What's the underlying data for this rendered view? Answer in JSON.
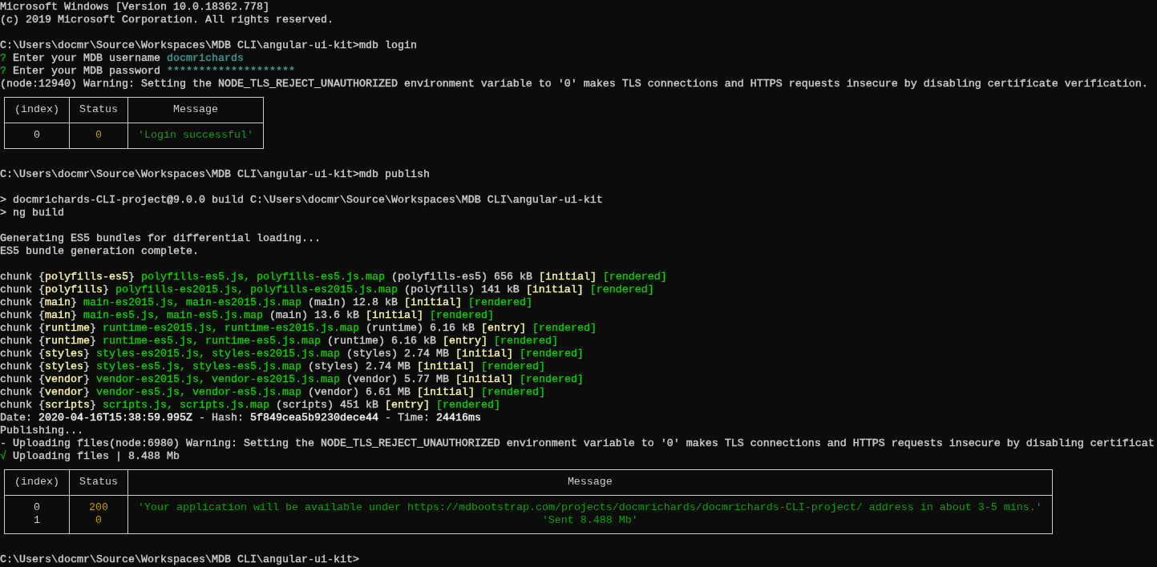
{
  "console": {
    "lines": [
      {
        "kind": "text",
        "segments": [
          {
            "text": "Microsoft Windows [Version 10.0.18362.778]",
            "color": "#cccccc"
          }
        ]
      },
      {
        "kind": "text",
        "segments": [
          {
            "text": "(c) 2019 Microsoft Corporation. All rights reserved.",
            "color": "#cccccc"
          }
        ]
      },
      {
        "kind": "blank"
      },
      {
        "kind": "text",
        "segments": [
          {
            "text": "C:\\Users\\docmr\\Source\\Workspaces\\MDB CLI\\angular-ui-kit>mdb login",
            "color": "#cccccc"
          }
        ]
      },
      {
        "kind": "text",
        "segments": [
          {
            "text": "?",
            "color": "#13a10e"
          },
          {
            "text": " Enter your MDB username ",
            "color": "#cccccc"
          },
          {
            "text": "docmrichards",
            "color": "#3a9a8f"
          }
        ]
      },
      {
        "kind": "text",
        "segments": [
          {
            "text": "?",
            "color": "#13a10e"
          },
          {
            "text": " Enter your MDB password ",
            "color": "#cccccc"
          },
          {
            "text": "********************",
            "color": "#3a9a8f"
          }
        ]
      },
      {
        "kind": "text",
        "segments": [
          {
            "text": "(node:12940) Warning: Setting the NODE_TLS_REJECT_UNAUTHORIZED environment variable to '0' makes TLS connections and HTTPS requests insecure by disabling certificate verification.",
            "color": "#cccccc"
          }
        ]
      },
      {
        "kind": "table",
        "columns": [
          "(index)",
          "Status",
          "Message"
        ],
        "rows": [
          [
            {
              "text": "0",
              "color": "#cccccc"
            },
            {
              "text": "0",
              "color": "#c19c00"
            },
            {
              "text": "'Login successful'",
              "color": "#13a10e"
            }
          ]
        ]
      },
      {
        "kind": "blank"
      },
      {
        "kind": "text",
        "segments": [
          {
            "text": "C:\\Users\\docmr\\Source\\Workspaces\\MDB CLI\\angular-ui-kit>mdb publish",
            "color": "#cccccc"
          }
        ]
      },
      {
        "kind": "blank"
      },
      {
        "kind": "text",
        "segments": [
          {
            "text": "> docmrichards-CLI-project@9.0.0 build C:\\Users\\docmr\\Source\\Workspaces\\MDB CLI\\angular-ui-kit",
            "color": "#cccccc"
          }
        ]
      },
      {
        "kind": "text",
        "segments": [
          {
            "text": "> ng build",
            "color": "#cccccc"
          }
        ]
      },
      {
        "kind": "blank"
      },
      {
        "kind": "text",
        "segments": [
          {
            "text": "Generating ES5 bundles for differential loading...",
            "color": "#cccccc"
          }
        ]
      },
      {
        "kind": "text",
        "segments": [
          {
            "text": "ES5 bundle generation complete.",
            "color": "#cccccc"
          }
        ]
      },
      {
        "kind": "blank"
      },
      {
        "kind": "text",
        "segments": [
          {
            "text": "chunk {",
            "color": "#cccccc"
          },
          {
            "text": "polyfills-es5",
            "color": "#f9f1a5"
          },
          {
            "text": "} ",
            "color": "#cccccc"
          },
          {
            "text": "polyfills-es5.js, polyfills-es5.js.map",
            "color": "#16c60c"
          },
          {
            "text": " (polyfills-es5) 656 kB ",
            "color": "#cccccc"
          },
          {
            "text": "[initial] ",
            "color": "#f9f1a5"
          },
          {
            "text": "[rendered]",
            "color": "#16c60c"
          }
        ]
      },
      {
        "kind": "text",
        "segments": [
          {
            "text": "chunk {",
            "color": "#cccccc"
          },
          {
            "text": "polyfills",
            "color": "#f9f1a5"
          },
          {
            "text": "} ",
            "color": "#cccccc"
          },
          {
            "text": "polyfills-es2015.js, polyfills-es2015.js.map",
            "color": "#16c60c"
          },
          {
            "text": " (polyfills) 141 kB ",
            "color": "#cccccc"
          },
          {
            "text": "[initial] ",
            "color": "#f9f1a5"
          },
          {
            "text": "[rendered]",
            "color": "#16c60c"
          }
        ]
      },
      {
        "kind": "text",
        "segments": [
          {
            "text": "chunk {",
            "color": "#cccccc"
          },
          {
            "text": "main",
            "color": "#f9f1a5"
          },
          {
            "text": "} ",
            "color": "#cccccc"
          },
          {
            "text": "main-es2015.js, main-es2015.js.map",
            "color": "#16c60c"
          },
          {
            "text": " (main) 12.8 kB ",
            "color": "#cccccc"
          },
          {
            "text": "[initial] ",
            "color": "#f9f1a5"
          },
          {
            "text": "[rendered]",
            "color": "#16c60c"
          }
        ]
      },
      {
        "kind": "text",
        "segments": [
          {
            "text": "chunk {",
            "color": "#cccccc"
          },
          {
            "text": "main",
            "color": "#f9f1a5"
          },
          {
            "text": "} ",
            "color": "#cccccc"
          },
          {
            "text": "main-es5.js, main-es5.js.map",
            "color": "#16c60c"
          },
          {
            "text": " (main) 13.6 kB ",
            "color": "#cccccc"
          },
          {
            "text": "[initial] ",
            "color": "#f9f1a5"
          },
          {
            "text": "[rendered]",
            "color": "#16c60c"
          }
        ]
      },
      {
        "kind": "text",
        "segments": [
          {
            "text": "chunk {",
            "color": "#cccccc"
          },
          {
            "text": "runtime",
            "color": "#f9f1a5"
          },
          {
            "text": "} ",
            "color": "#cccccc"
          },
          {
            "text": "runtime-es2015.js, runtime-es2015.js.map",
            "color": "#16c60c"
          },
          {
            "text": " (runtime) 6.16 kB ",
            "color": "#cccccc"
          },
          {
            "text": "[entry] ",
            "color": "#f9f1a5"
          },
          {
            "text": "[rendered]",
            "color": "#16c60c"
          }
        ]
      },
      {
        "kind": "text",
        "segments": [
          {
            "text": "chunk {",
            "color": "#cccccc"
          },
          {
            "text": "runtime",
            "color": "#f9f1a5"
          },
          {
            "text": "} ",
            "color": "#cccccc"
          },
          {
            "text": "runtime-es5.js, runtime-es5.js.map",
            "color": "#16c60c"
          },
          {
            "text": " (runtime) 6.16 kB ",
            "color": "#cccccc"
          },
          {
            "text": "[entry] ",
            "color": "#f9f1a5"
          },
          {
            "text": "[rendered]",
            "color": "#16c60c"
          }
        ]
      },
      {
        "kind": "text",
        "segments": [
          {
            "text": "chunk {",
            "color": "#cccccc"
          },
          {
            "text": "styles",
            "color": "#f9f1a5"
          },
          {
            "text": "} ",
            "color": "#cccccc"
          },
          {
            "text": "styles-es2015.js, styles-es2015.js.map",
            "color": "#16c60c"
          },
          {
            "text": " (styles) 2.74 MB ",
            "color": "#cccccc"
          },
          {
            "text": "[initial] ",
            "color": "#f9f1a5"
          },
          {
            "text": "[rendered]",
            "color": "#16c60c"
          }
        ]
      },
      {
        "kind": "text",
        "segments": [
          {
            "text": "chunk {",
            "color": "#cccccc"
          },
          {
            "text": "styles",
            "color": "#f9f1a5"
          },
          {
            "text": "} ",
            "color": "#cccccc"
          },
          {
            "text": "styles-es5.js, styles-es5.js.map",
            "color": "#16c60c"
          },
          {
            "text": " (styles) 2.74 MB ",
            "color": "#cccccc"
          },
          {
            "text": "[initial] ",
            "color": "#f9f1a5"
          },
          {
            "text": "[rendered]",
            "color": "#16c60c"
          }
        ]
      },
      {
        "kind": "text",
        "segments": [
          {
            "text": "chunk {",
            "color": "#cccccc"
          },
          {
            "text": "vendor",
            "color": "#f9f1a5"
          },
          {
            "text": "} ",
            "color": "#cccccc"
          },
          {
            "text": "vendor-es2015.js, vendor-es2015.js.map",
            "color": "#16c60c"
          },
          {
            "text": " (vendor) 5.77 MB ",
            "color": "#cccccc"
          },
          {
            "text": "[initial] ",
            "color": "#f9f1a5"
          },
          {
            "text": "[rendered]",
            "color": "#16c60c"
          }
        ]
      },
      {
        "kind": "text",
        "segments": [
          {
            "text": "chunk {",
            "color": "#cccccc"
          },
          {
            "text": "vendor",
            "color": "#f9f1a5"
          },
          {
            "text": "} ",
            "color": "#cccccc"
          },
          {
            "text": "vendor-es5.js, vendor-es5.js.map",
            "color": "#16c60c"
          },
          {
            "text": " (vendor) 6.61 MB ",
            "color": "#cccccc"
          },
          {
            "text": "[initial] ",
            "color": "#f9f1a5"
          },
          {
            "text": "[rendered]",
            "color": "#16c60c"
          }
        ]
      },
      {
        "kind": "text",
        "segments": [
          {
            "text": "chunk {",
            "color": "#cccccc"
          },
          {
            "text": "scripts",
            "color": "#f9f1a5"
          },
          {
            "text": "} ",
            "color": "#cccccc"
          },
          {
            "text": "scripts.js, scripts.js.map",
            "color": "#16c60c"
          },
          {
            "text": " (scripts) 451 kB ",
            "color": "#cccccc"
          },
          {
            "text": "[entry] ",
            "color": "#f9f1a5"
          },
          {
            "text": "[rendered]",
            "color": "#16c60c"
          }
        ]
      },
      {
        "kind": "text",
        "segments": [
          {
            "text": "Date: ",
            "color": "#cccccc"
          },
          {
            "text": "2020-04-16T15:38:59.995Z",
            "color": "#f2f2f2"
          },
          {
            "text": " - Hash: ",
            "color": "#cccccc"
          },
          {
            "text": "5f849cea5b9230dece44",
            "color": "#f2f2f2"
          },
          {
            "text": " - Time: ",
            "color": "#cccccc"
          },
          {
            "text": "24416ms",
            "color": "#f2f2f2"
          }
        ]
      },
      {
        "kind": "text",
        "segments": [
          {
            "text": "Publishing...",
            "color": "#cccccc"
          }
        ]
      },
      {
        "kind": "text",
        "segments": [
          {
            "text": "- Uploading files(node:6980) Warning: Setting the NODE_TLS_REJECT_UNAUTHORIZED environment variable to '0' makes TLS connections and HTTPS requests insecure by disabling certificat",
            "color": "#cccccc"
          }
        ]
      },
      {
        "kind": "text",
        "segments": [
          {
            "text": "√",
            "color": "#13a10e"
          },
          {
            "text": " Uploading files | 8.488 Mb",
            "color": "#cccccc"
          }
        ]
      },
      {
        "kind": "table",
        "columns": [
          "(index)",
          "Status",
          "Message"
        ],
        "rows": [
          [
            {
              "text": "0",
              "color": "#cccccc"
            },
            {
              "text": "200",
              "color": "#c19c00"
            },
            {
              "text": "'Your application will be available under https://mdbootstrap.com/projects/docmrichards/docmrichards-CLI-project/ address in about 3-5 mins.'",
              "color": "#13a10e"
            }
          ],
          [
            {
              "text": "1",
              "color": "#cccccc"
            },
            {
              "text": "0",
              "color": "#c19c00"
            },
            {
              "text": "'Sent 8.488 Mb'",
              "color": "#13a10e"
            }
          ]
        ]
      },
      {
        "kind": "blank"
      },
      {
        "kind": "text",
        "segments": [
          {
            "text": "C:\\Users\\docmr\\Source\\Workspaces\\MDB CLI\\angular-ui-kit>",
            "color": "#cccccc"
          }
        ]
      }
    ]
  }
}
